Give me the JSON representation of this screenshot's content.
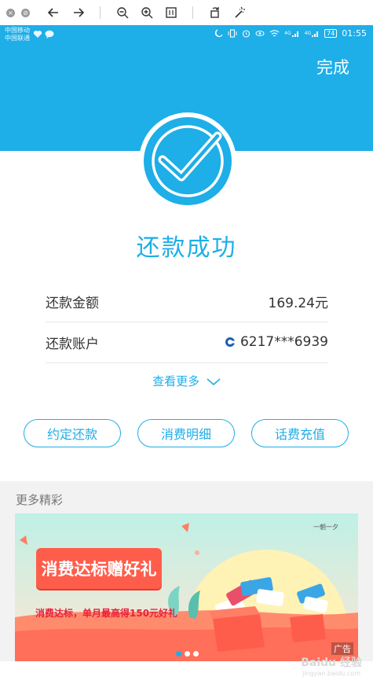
{
  "statusbar": {
    "carrier1": "中国移动",
    "carrier2": "中国联通",
    "network1": "4G",
    "network2": "4G",
    "battery": "74",
    "time": "01:55"
  },
  "header": {
    "done_label": "完成"
  },
  "result": {
    "title": "还款成功",
    "rows": [
      {
        "label": "还款金额",
        "value": "169.24元"
      },
      {
        "label": "还款账户",
        "value": "6217***6939"
      }
    ],
    "more_label": "查看更多"
  },
  "actions": [
    {
      "label": "约定还款"
    },
    {
      "label": "消费明细"
    },
    {
      "label": "话费充值"
    }
  ],
  "more_section": {
    "title": "更多精彩",
    "banner": {
      "headline": "消费达标赠好礼",
      "subline": "消费达标，单月最高得150元好礼",
      "ad_tag": "广告"
    }
  },
  "colors": {
    "primary": "#1eaee8",
    "promo": "#ff5d4b"
  },
  "watermark": {
    "text": "Baidu 经验",
    "sub": "jingyan.baidu.com"
  }
}
